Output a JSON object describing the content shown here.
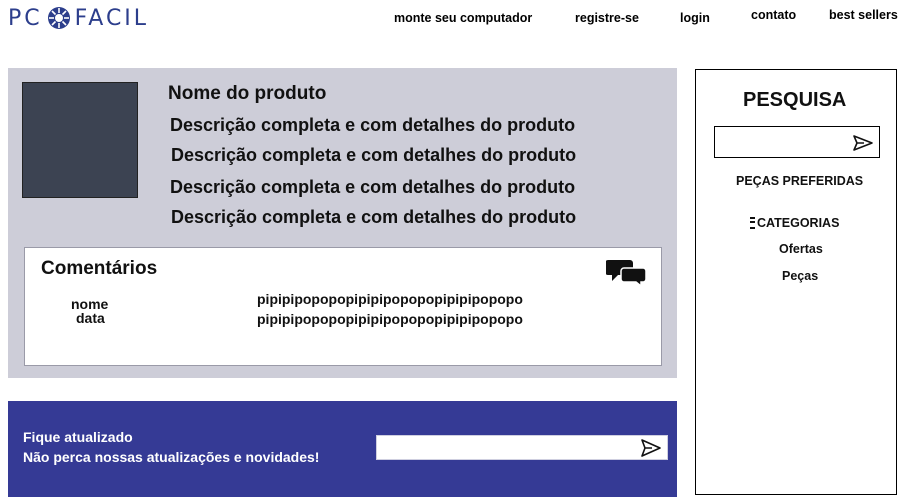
{
  "header": {
    "logo_left": "PC",
    "logo_right": "FACIL",
    "nav": {
      "monte": "monte seu computador",
      "registre": "registre-se",
      "login": "login",
      "contato": "contato",
      "best": "best sellers"
    }
  },
  "product": {
    "title": "Nome do produto",
    "desc_1": "Descrição completa e com detalhes do produto",
    "desc_2": "Descrição completa e com detalhes do produto",
    "desc_3": "Descrição completa e com detalhes do produto",
    "desc_4": "Descrição completa e com detalhes do produto"
  },
  "comments": {
    "title": "Comentários",
    "nome": "nome",
    "data": "data",
    "line_1": "pipipipopopopipipipopopopipipipopopo",
    "line_2": "pipipipopopopipipipopopopipipipopopo"
  },
  "newsletter": {
    "heading": "Fique atualizado",
    "subheading": "Não perca nossas atualizações e novidades!"
  },
  "sidebar": {
    "title": "PESQUISA",
    "pecas_preferidas": "PEÇAS PREFERIDAS",
    "categorias": "CATEGORIAS",
    "ofertas": "Ofertas",
    "pecas": "Peças"
  },
  "colors": {
    "brand": "#2c3e8c",
    "panel": "#cdcdd8",
    "newsletter": "#353a95",
    "image_placeholder": "#3c4352"
  }
}
